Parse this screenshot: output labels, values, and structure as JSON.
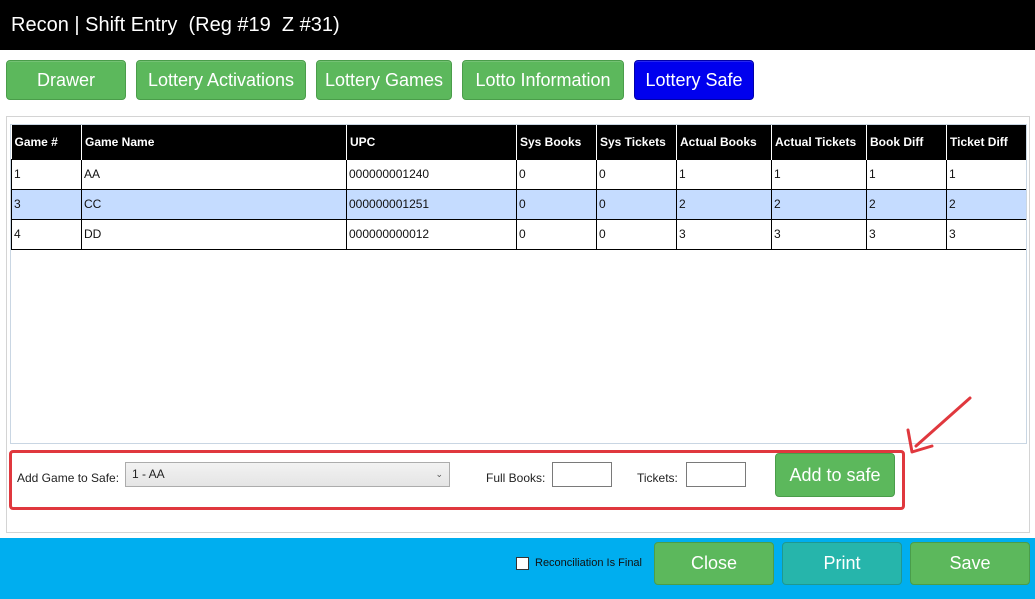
{
  "window": {
    "title": "Recon | Shift Entry  (Reg #19  Z #31)"
  },
  "tabs": [
    {
      "label": "Drawer",
      "active": false
    },
    {
      "label": "Lottery Activations",
      "active": false
    },
    {
      "label": "Lottery Games",
      "active": false
    },
    {
      "label": "Lotto Information",
      "active": false
    },
    {
      "label": "Lottery Safe",
      "active": true
    }
  ],
  "grid": {
    "columns": [
      "Game #",
      "Game Name",
      "UPC",
      "Sys Books",
      "Sys Tickets",
      "Actual Books",
      "Actual Tickets",
      "Book Diff",
      "Ticket Diff"
    ],
    "rows": [
      [
        "1",
        "AA",
        "000000001240",
        "0",
        "0",
        "1",
        "1",
        "1",
        "1"
      ],
      [
        "3",
        "CC",
        "000000001251",
        "0",
        "0",
        "2",
        "2",
        "2",
        "2"
      ],
      [
        "4",
        "DD",
        "000000000012",
        "0",
        "0",
        "3",
        "3",
        "3",
        "3"
      ]
    ],
    "selected_row": 1
  },
  "add_form": {
    "game_label": "Add Game to Safe:",
    "game_selected": "1 - AA",
    "full_books_label": "Full Books:",
    "full_books_value": "",
    "tickets_label": "Tickets:",
    "tickets_value": "",
    "add_button": "Add to safe"
  },
  "footer": {
    "final_checkbox_label": "Reconciliation Is Final",
    "final_checked": false,
    "close_button": "Close",
    "print_button": "Print",
    "save_button": "Save"
  },
  "colors": {
    "tab_green": "#5cb85c",
    "tab_active": "#0000ee",
    "footer_bg": "#00aeef",
    "highlight_red": "#e0383e",
    "selected_row": "#c5dcff"
  }
}
